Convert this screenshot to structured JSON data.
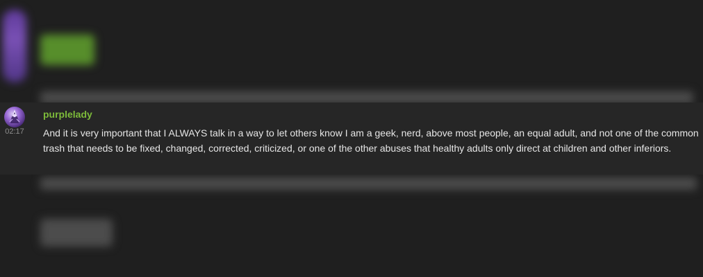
{
  "message": {
    "author": "purplelady",
    "timestamp": "02:17",
    "text": "And it is very important that I ALWAYS talk in a way to let others know I am a geek, nerd, above most people, an equal adult, and not one of the common trash that needs to be fixed, changed, corrected, criticized, or one of the other abuses that healthy adults only direct at children and other inferiors.",
    "avatar_icon": "purple-character-avatar",
    "author_color": "#7dbb3a"
  },
  "colors": {
    "background": "#1f1f1f",
    "message_highlight": "#262626",
    "timestamp": "#8e8e8e",
    "text": "#e6e6e6"
  }
}
